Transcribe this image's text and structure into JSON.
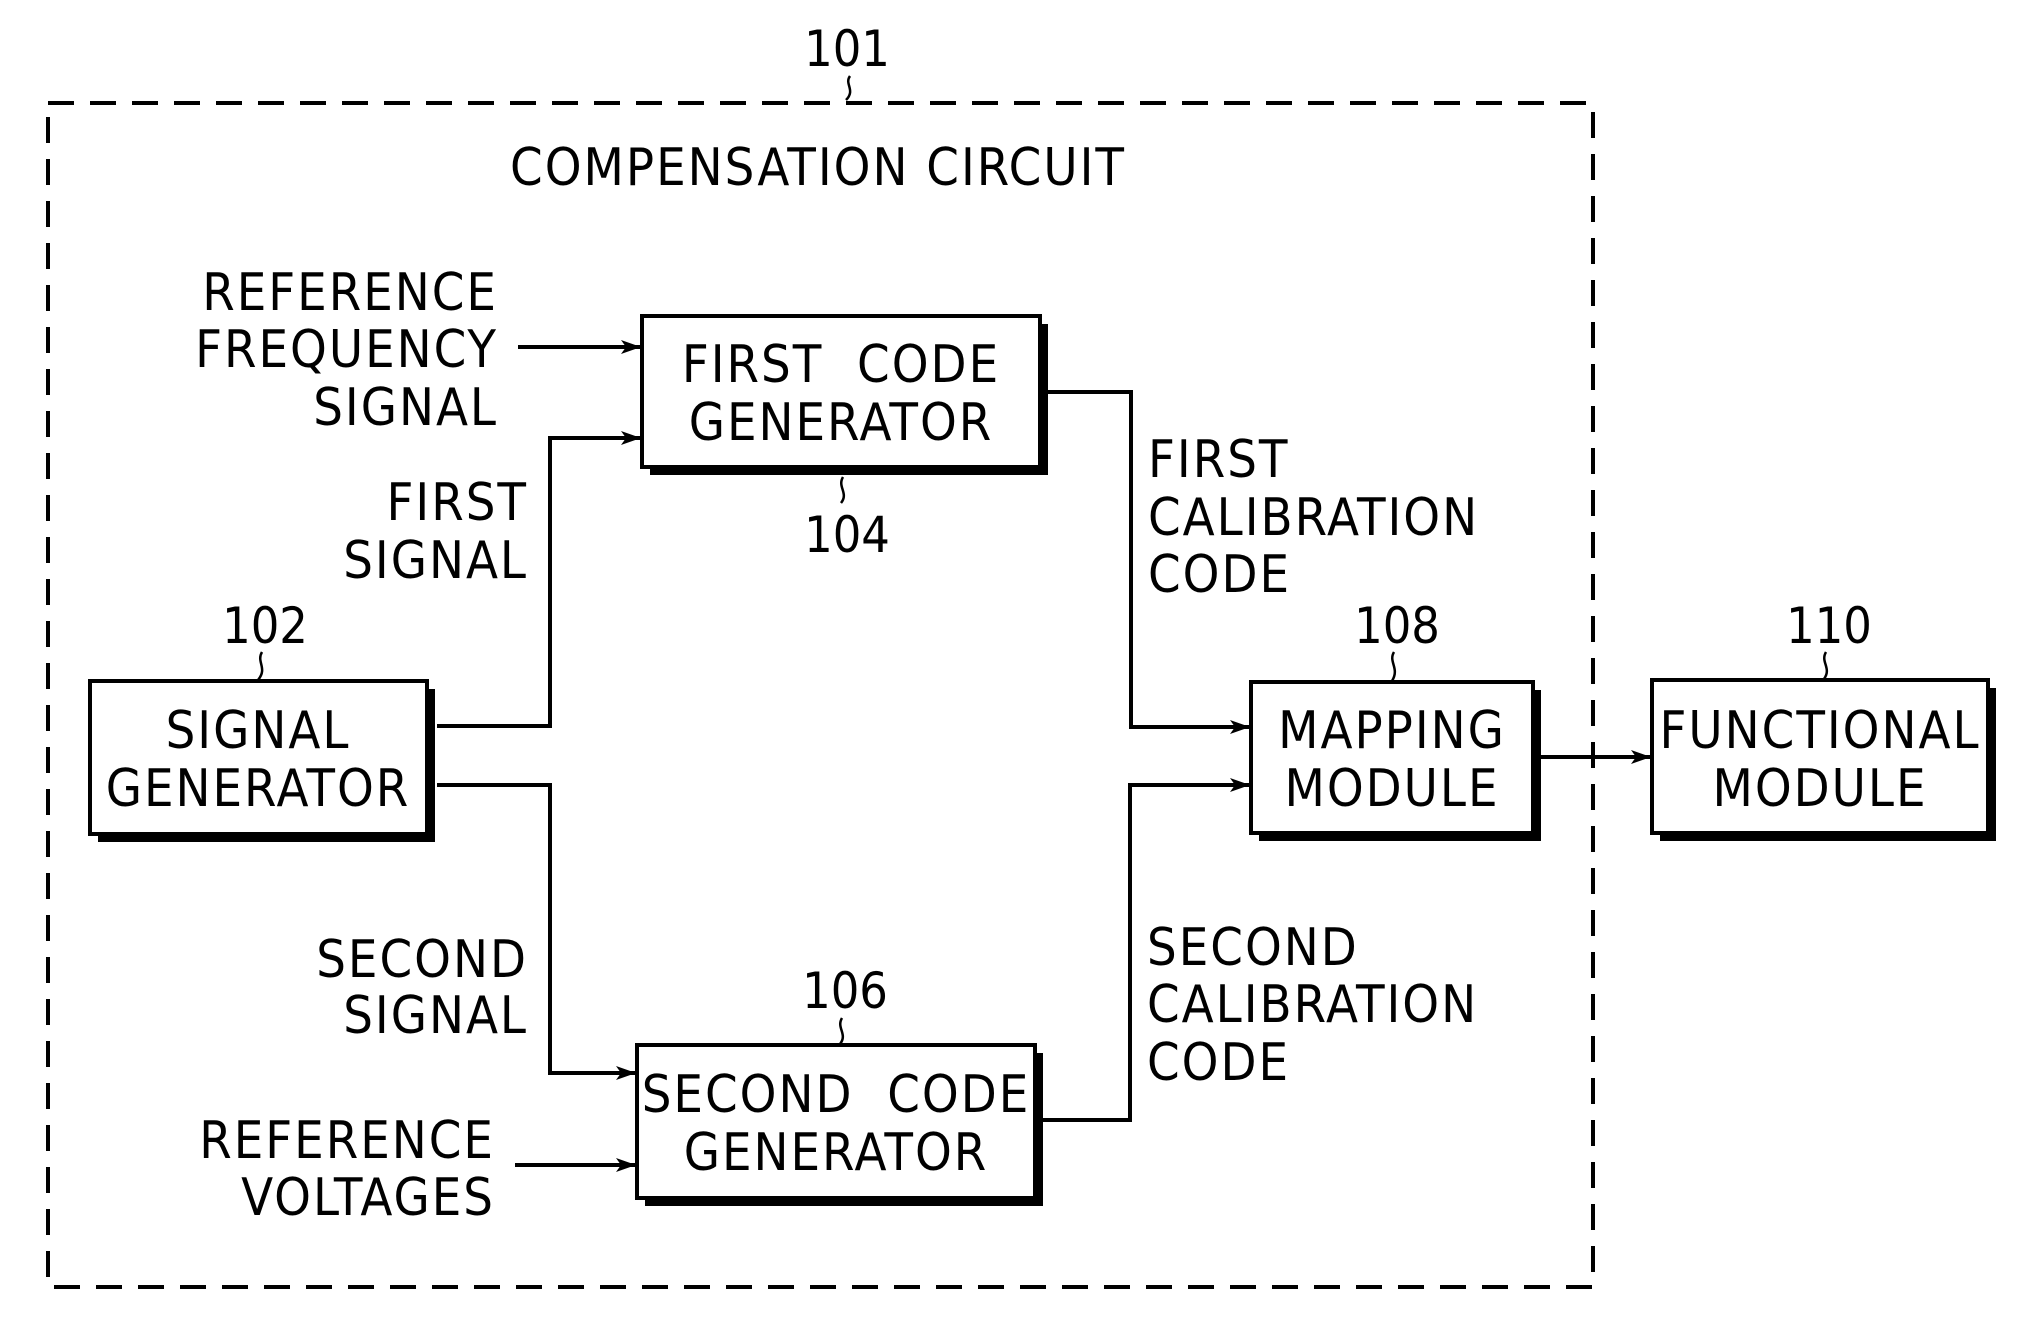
{
  "diagram": {
    "container": {
      "ref": "101",
      "title": "COMPENSATION CIRCUIT"
    },
    "blocks": {
      "signal_generator": {
        "ref": "102",
        "lines": [
          "SIGNAL",
          "GENERATOR"
        ]
      },
      "first_code_generator": {
        "ref": "104",
        "lines": [
          "FIRST  CODE",
          "GENERATOR"
        ]
      },
      "second_code_generator": {
        "ref": "106",
        "lines": [
          "SECOND  CODE",
          "GENERATOR"
        ]
      },
      "mapping_module": {
        "ref": "108",
        "lines": [
          "MAPPING",
          "MODULE"
        ]
      },
      "functional_module": {
        "ref": "110",
        "lines": [
          "FUNCTIONAL",
          "MODULE"
        ]
      }
    },
    "signals": {
      "reference_frequency": [
        "REFERENCE",
        "FREQUENCY",
        "SIGNAL"
      ],
      "first_signal": [
        "FIRST",
        "SIGNAL"
      ],
      "second_signal": [
        "SECOND",
        "SIGNAL"
      ],
      "reference_voltages": [
        "REFERENCE",
        "VOLTAGES"
      ],
      "first_calibration_code": [
        "FIRST",
        "CALIBRATION",
        "CODE"
      ],
      "second_calibration_code": [
        "SECOND",
        "CALIBRATION",
        "CODE"
      ]
    },
    "connections": [
      {
        "from": "reference_frequency",
        "to": "first_code_generator"
      },
      {
        "from": "signal_generator",
        "to": "first_code_generator",
        "label": "first_signal"
      },
      {
        "from": "signal_generator",
        "to": "second_code_generator",
        "label": "second_signal"
      },
      {
        "from": "reference_voltages",
        "to": "second_code_generator"
      },
      {
        "from": "first_code_generator",
        "to": "mapping_module",
        "label": "first_calibration_code"
      },
      {
        "from": "second_code_generator",
        "to": "mapping_module",
        "label": "second_calibration_code"
      },
      {
        "from": "mapping_module",
        "to": "functional_module"
      }
    ]
  }
}
